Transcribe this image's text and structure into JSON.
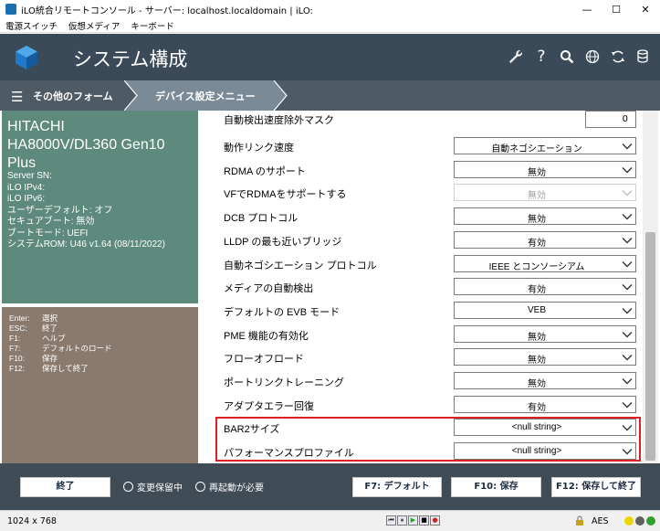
{
  "window": {
    "title": "iLO統合リモートコンソール - サーバー: localhost.localdomain | iLO:",
    "minimize": "—",
    "maximize": "☐",
    "close": "✕"
  },
  "menu": [
    "電源スイッチ",
    "仮想メディア",
    "キーボード"
  ],
  "header": {
    "title": "システム構成"
  },
  "breadcrumb": {
    "menu_icon": "☰",
    "level1": "その他のフォーム",
    "level2": "デバイス設定メニュー"
  },
  "server_info": {
    "model_line1": "HITACHI",
    "model_line2": "HA8000V/DL360 Gen10",
    "model_line3": "Plus",
    "lines": [
      "Server SN:",
      "iLO IPv4:",
      "iLO IPv6:",
      "ユーザーデフォルト: オフ",
      "セキュアブート: 無効",
      "ブートモード: UEFI",
      "システムROM: U46 v1.64 (08/11/2022)"
    ]
  },
  "help": [
    {
      "key": "Enter:",
      "desc": "選択"
    },
    {
      "key": "ESC:",
      "desc": "終了"
    },
    {
      "key": "F1:",
      "desc": "ヘルプ"
    },
    {
      "key": "F7:",
      "desc": "デフォルトのロード"
    },
    {
      "key": "F10:",
      "desc": "保存"
    },
    {
      "key": "F12:",
      "desc": "保存して終了"
    }
  ],
  "settings": {
    "first": {
      "label": "自動検出速度除外マスク",
      "value": "0"
    },
    "rows": [
      {
        "label": "動作リンク速度",
        "value": "自動ネゴシエーション",
        "disabled": false
      },
      {
        "label": "RDMA のサポート",
        "value": "無効",
        "disabled": false
      },
      {
        "label": "VFでRDMAをサポートする",
        "value": "無効",
        "disabled": true
      },
      {
        "label": "DCB プロトコル",
        "value": "無効",
        "disabled": false
      },
      {
        "label": "LLDP の最も近いブリッジ",
        "value": "有効",
        "disabled": false
      },
      {
        "label": "自動ネゴシエーション プロトコル",
        "value": "IEEE とコンソーシアム",
        "disabled": false
      },
      {
        "label": "メディアの自動検出",
        "value": "有効",
        "disabled": false
      },
      {
        "label": "デフォルトの EVB モード",
        "value": "VEB",
        "disabled": false
      },
      {
        "label": "PME 機能の有効化",
        "value": "無効",
        "disabled": false
      },
      {
        "label": "フローオフロード",
        "value": "無効",
        "disabled": false
      },
      {
        "label": "ポートリンクトレーニング",
        "value": "無効",
        "disabled": false
      },
      {
        "label": "アダプタエラー回復",
        "value": "有効",
        "disabled": false
      },
      {
        "label": "BAR2サイズ",
        "value": "<null string>",
        "disabled": false
      },
      {
        "label": "パフォーマンスプロファイル",
        "value": "<null string>",
        "disabled": false
      }
    ]
  },
  "footer": {
    "exit_label": "終了",
    "radio1": "変更保留中",
    "radio2": "再起動が必要",
    "f7_label": "F7: デフォルト",
    "f10_label": "F10: 保存",
    "f12_label": "F12: 保存して終了"
  },
  "statusbar": {
    "resolution": "1024 x 768",
    "encryption": "AES",
    "media_buttons": [
      "⏮",
      "⏸",
      "▶",
      "■",
      "●"
    ],
    "indicator_colors": [
      "#e8d800",
      "#606060",
      "#30a030"
    ]
  },
  "colors": {
    "header_bg": "#3a4a58",
    "info_panel_bg": "#5e8a7e",
    "help_panel_bg": "#8a7a6e",
    "footer_bg": "#3f4b55",
    "highlight_border": "#e02020"
  }
}
